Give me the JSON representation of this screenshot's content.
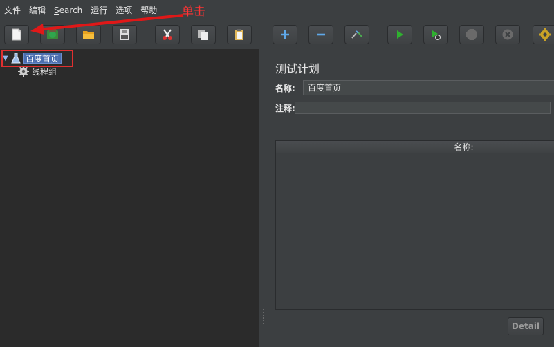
{
  "menu": {
    "items": [
      "文件",
      "编辑",
      "Search",
      "运行",
      "选项",
      "帮助"
    ]
  },
  "annotation": {
    "text": "单击",
    "color": "#ff3333"
  },
  "toolbar": {
    "buttons": [
      {
        "name": "new-icon"
      },
      {
        "name": "templates-icon"
      },
      {
        "name": "open-icon"
      },
      {
        "name": "save-icon"
      },
      {
        "name": "cut-icon"
      },
      {
        "name": "copy-icon"
      },
      {
        "name": "paste-icon"
      },
      {
        "name": "expand-icon"
      },
      {
        "name": "collapse-icon"
      },
      {
        "name": "toggle-icon"
      },
      {
        "name": "start-icon"
      },
      {
        "name": "start-no-pauses-icon"
      },
      {
        "name": "stop-icon"
      },
      {
        "name": "shutdown-icon"
      },
      {
        "name": "gear-icon"
      }
    ]
  },
  "tree": {
    "root_label": "百度首页",
    "child_label": "线程组"
  },
  "panel": {
    "title": "测试计划",
    "name_label": "名称:",
    "name_value": "百度首页",
    "comment_label": "注释:",
    "comment_value": "",
    "table_header": "名称:",
    "detail_button": "Detail"
  },
  "colors": {
    "selection": "#4b6eaf",
    "highlight_box": "#e03030",
    "play_green": "#2fb12f"
  }
}
